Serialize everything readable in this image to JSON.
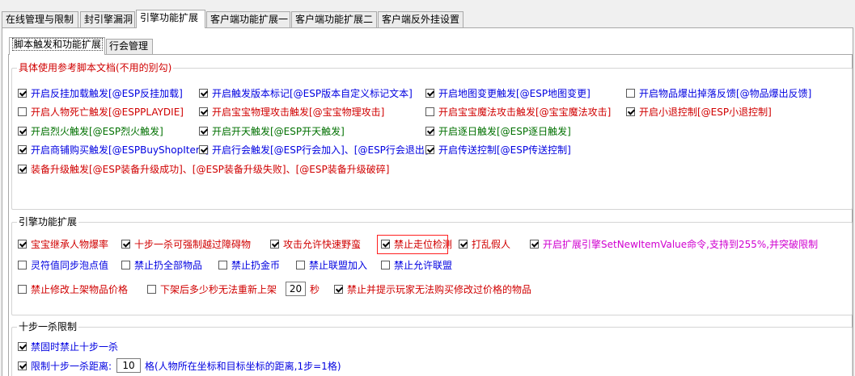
{
  "tabs": [
    {
      "label": "在线管理与限制",
      "active": false
    },
    {
      "label": "封引擎漏洞",
      "active": false
    },
    {
      "label": "引擎功能扩展",
      "active": true
    },
    {
      "label": "客户端功能扩展一",
      "active": false
    },
    {
      "label": "客户端功能扩展二",
      "active": false
    },
    {
      "label": "客户端反外挂设置",
      "active": false
    }
  ],
  "subtabs": [
    {
      "label": "脚本触发和功能扩展",
      "active": true
    },
    {
      "label": "行会管理",
      "active": false
    }
  ],
  "script_group": {
    "legend": "具体使用参考脚本文档(不用的别勾)",
    "items": [
      {
        "label": "开启反挂加载触发[@ESP反挂加载]",
        "checked": true,
        "color": "blue"
      },
      {
        "label": "开启触发版本标记[@ESP版本自定义标记文本]",
        "checked": true,
        "color": "blue"
      },
      {
        "label": "开启地图变更触发[@ESP地图变更]",
        "checked": true,
        "color": "blue"
      },
      {
        "label": "开启物品爆出掉落反馈[@物品爆出反馈]",
        "checked": false,
        "color": "blue"
      },
      {
        "label": "开启人物死亡触发[@ESPPLAYDIE]",
        "checked": false,
        "color": "red"
      },
      {
        "label": "开启宝宝物理攻击触发[@宝宝物理攻击]",
        "checked": true,
        "color": "red"
      },
      {
        "label": "开启宝宝魔法攻击触发[@宝宝魔法攻击]",
        "checked": false,
        "color": "red"
      },
      {
        "label": "开启小退控制[@ESP小退控制]",
        "checked": true,
        "color": "red"
      },
      {
        "label": "开启烈火触发[@ESP烈火触发]",
        "checked": true,
        "color": "green"
      },
      {
        "label": "开启开天触发[@ESP开天触发]",
        "checked": true,
        "color": "green"
      },
      {
        "label": "开启逐日触发[@ESP逐日触发]",
        "checked": true,
        "color": "green"
      },
      {
        "label": "开启商铺购买触发[@ESPBuyShopItem]",
        "checked": true,
        "color": "blue"
      },
      {
        "label": "开启行会触发[@ESP行会加入]、[@ESP行会退出]",
        "checked": true,
        "color": "blue"
      },
      {
        "label": "开启传送控制[@ESP传送控制]",
        "checked": true,
        "color": "blue"
      },
      {
        "label": "装备升级触发[@ESP装备升级成功]、[@ESP装备升级失败]、[@ESP装备升级破碎]",
        "checked": true,
        "color": "red"
      }
    ]
  },
  "engine_group": {
    "legend": "引擎功能扩展",
    "items": [
      {
        "label": "宝宝继承人物爆率",
        "checked": true,
        "color": "red"
      },
      {
        "label": "十步一杀可强制越过障碍物",
        "checked": true,
        "color": "red"
      },
      {
        "label": "攻击允许快速野蛮",
        "checked": true,
        "color": "red"
      },
      {
        "label": "禁止走位检测",
        "checked": true,
        "color": "red"
      },
      {
        "label": "打乱假人",
        "checked": true,
        "color": "red"
      },
      {
        "label": "开启扩展引擎SetNewItemValue命令,支持到255%,并突破限制",
        "checked": true,
        "color": "magenta"
      },
      {
        "label": "灵符值同步泡点值",
        "checked": false,
        "color": "blue"
      },
      {
        "label": "禁止扔全部物品",
        "checked": false,
        "color": "blue"
      },
      {
        "label": "禁止扔金币",
        "checked": false,
        "color": "blue"
      },
      {
        "label": "禁止联盟加入",
        "checked": false,
        "color": "blue"
      },
      {
        "label": "禁止允许联盟",
        "checked": false,
        "color": "blue"
      },
      {
        "label": "禁止修改上架物品价格",
        "checked": false,
        "color": "red"
      },
      {
        "label": "下架后多少秒无法重新上架",
        "checked": false,
        "color": "red"
      },
      {
        "label": "禁止并提示玩家无法购买修改过价格的物品",
        "checked": true,
        "color": "red"
      }
    ],
    "relist_seconds_value": "20",
    "relist_seconds_unit": "秒"
  },
  "tenstep_group": {
    "legend": "十步一杀限制",
    "ban_label": "禁固时禁止十步一杀",
    "ban_checked": true,
    "distance_label": "限制十步一杀距离:",
    "distance_checked": true,
    "distance_value": "10",
    "distance_hint": "格(人物所在坐标和目标坐标的距离,1步=1格)"
  }
}
